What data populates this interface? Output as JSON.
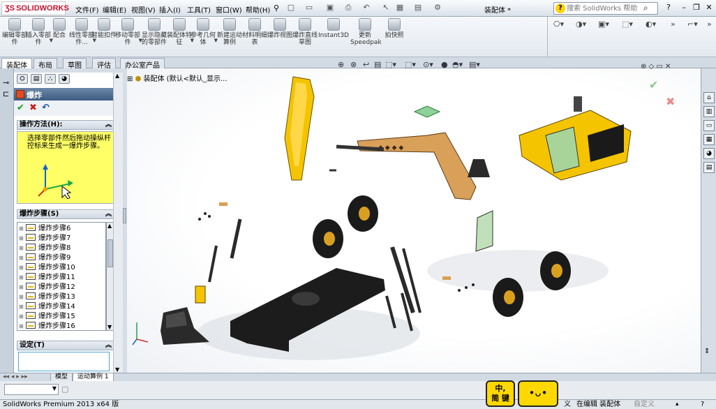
{
  "app": {
    "logo_text": "SOLIDWORKS",
    "doc_title": "装配体 *"
  },
  "menu": {
    "file": "文件(F)",
    "edit": "编辑(E)",
    "view": "视图(V)",
    "insert": "插入(I)",
    "tools": "工具(T)",
    "window": "窗口(W)",
    "help": "帮助(H)"
  },
  "help_search": {
    "placeholder": "搜索 SolidWorks 帮助"
  },
  "command_manager": {
    "buttons": [
      {
        "label": "编辑零部件"
      },
      {
        "label": "插入零部件"
      },
      {
        "label": "配合"
      },
      {
        "label": "线性零部件..."
      },
      {
        "label": "智能扣件"
      },
      {
        "label": "移动零部件"
      },
      {
        "label": "显示隐藏的零部件"
      },
      {
        "label": "装配体特征"
      },
      {
        "label": "参考几何体"
      },
      {
        "label": "新建运动算例"
      },
      {
        "label": "材料明细表"
      },
      {
        "label": "爆炸视图"
      },
      {
        "label": "爆炸直线草图"
      },
      {
        "label": "Instant3D"
      },
      {
        "label": "更新Speedpak"
      },
      {
        "label": "拍快照"
      }
    ]
  },
  "tabs": [
    "装配体",
    "布局",
    "草图",
    "评估",
    "办公室产品"
  ],
  "property_manager": {
    "title": "爆炸",
    "help": "?",
    "method_group": "操作方法(H):",
    "method_text": "选择零部件然后拖动操纵杆控标来生成一爆炸步骤。",
    "steps_group": "爆炸步骤(S)",
    "steps": [
      "爆炸步骤6",
      "爆炸步骤7",
      "爆炸步骤8",
      "爆炸步骤9",
      "爆炸步骤10",
      "爆炸步骤11",
      "爆炸步骤12",
      "爆炸步骤13",
      "爆炸步骤14",
      "爆炸步骤15",
      "爆炸步骤16"
    ],
    "settings_group": "设定(T)"
  },
  "viewport": {
    "tree_root": "装配体 (默认<默认_显示..."
  },
  "bottom_tabs": [
    "模型",
    "运动算例 1"
  ],
  "status": {
    "product": "SolidWorks Premium 2013 x64 版",
    "editing": "在编辑 装配体",
    "custom": "自定义",
    "left_cut": "义"
  },
  "ime": {
    "mode_line1": "中,",
    "mode_line2": "简 键"
  },
  "colors": {
    "part_yellow": "#f5c400",
    "part_dark": "#222222",
    "panel_blue": "#3e5c82",
    "method_bg": "#ffff66"
  }
}
